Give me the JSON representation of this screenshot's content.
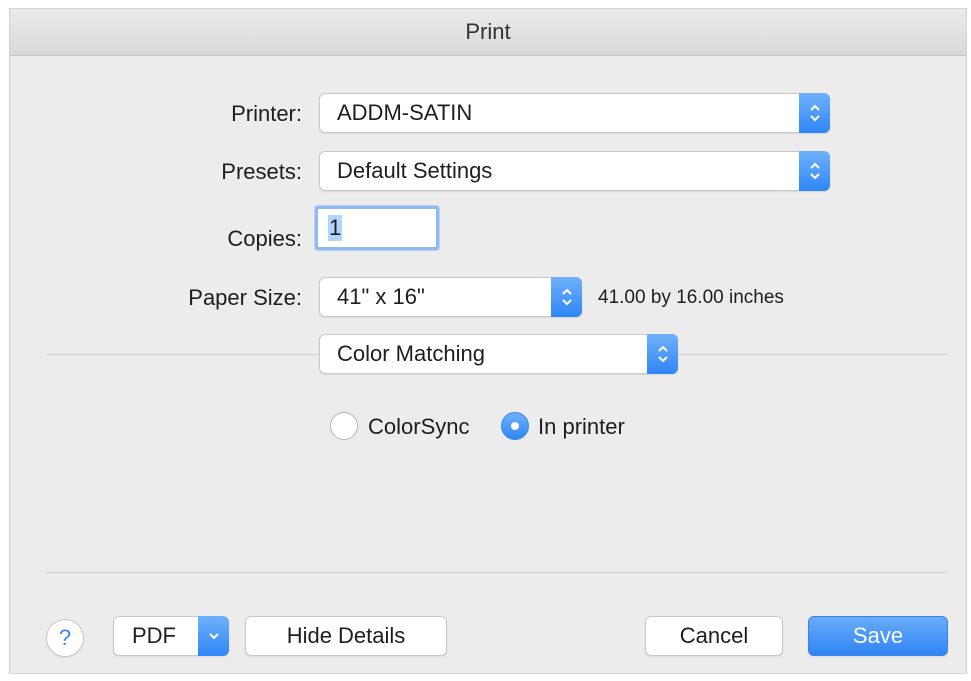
{
  "window": {
    "title": "Print"
  },
  "form": {
    "printer": {
      "label": "Printer:",
      "value": "ADDM-SATIN"
    },
    "presets": {
      "label": "Presets:",
      "value": "Default Settings"
    },
    "copies": {
      "label": "Copies:",
      "value": "1"
    },
    "paper_size": {
      "label": "Paper Size:",
      "value": "41\" x 16\"",
      "hint": "41.00 by 16.00 inches"
    },
    "section": {
      "value": "Color Matching"
    },
    "color_matching": {
      "options": [
        {
          "label": "ColorSync",
          "selected": false
        },
        {
          "label": "In printer",
          "selected": true
        }
      ]
    }
  },
  "footer": {
    "help_label": "?",
    "pdf_label": "PDF",
    "details_label": "Hide Details",
    "cancel_label": "Cancel",
    "save_label": "Save"
  },
  "colors": {
    "accent": "#2f86f6",
    "background": "#ececec"
  }
}
